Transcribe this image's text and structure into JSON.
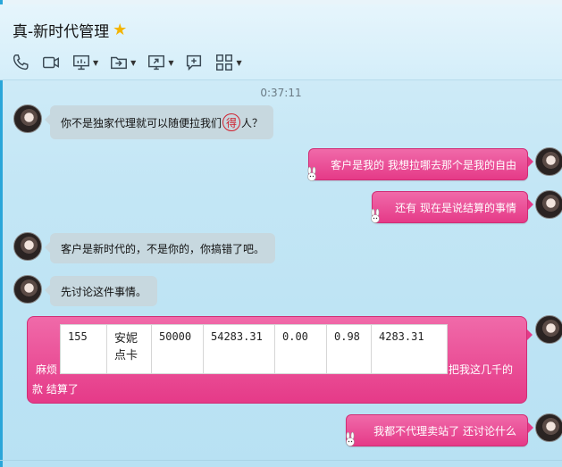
{
  "window": {
    "title": "真-新时代管理",
    "star_icon": "star-icon"
  },
  "toolbar": {
    "items": [
      {
        "icon": "phone-icon"
      },
      {
        "icon": "video-icon"
      },
      {
        "icon": "presentation-icon",
        "has_menu": true
      },
      {
        "icon": "file-transfer-icon",
        "has_menu": true
      },
      {
        "icon": "screen-share-icon",
        "has_menu": true
      },
      {
        "icon": "remote-assist-icon"
      },
      {
        "icon": "apps-icon",
        "has_menu": true
      }
    ]
  },
  "chat": {
    "timestamp": "0:37:11",
    "messages": [
      {
        "side": "left",
        "text_before": "你不是独家代理就可以随便拉我们",
        "emphasis": "得",
        "text_after": "人？"
      },
      {
        "side": "right",
        "text": "客户是我的 我想拉哪去那个是我的自由"
      },
      {
        "side": "right",
        "text": "还有 现在是说结算的事情"
      },
      {
        "side": "left",
        "text": "客户是新时代的，不是你的，你搞错了吧。"
      },
      {
        "side": "left",
        "text": "先讨论这件事情。"
      },
      {
        "side": "right",
        "pre_text": "麻烦",
        "table_row": [
          "155",
          "安妮点卡",
          "50000",
          "54283.31",
          "0.00",
          "0.98",
          "4283.31"
        ],
        "post_text_line1": "把我这几千的",
        "post_text_line2": "款 结算了"
      },
      {
        "side": "right",
        "text": "我都不代理卖站了  还讨论什么"
      }
    ]
  },
  "colors": {
    "accent_pink": "#e53a88",
    "left_bubble": "#c7d8df",
    "header_bg": "#d4eef9",
    "emphasis_red": "#d0202e"
  }
}
